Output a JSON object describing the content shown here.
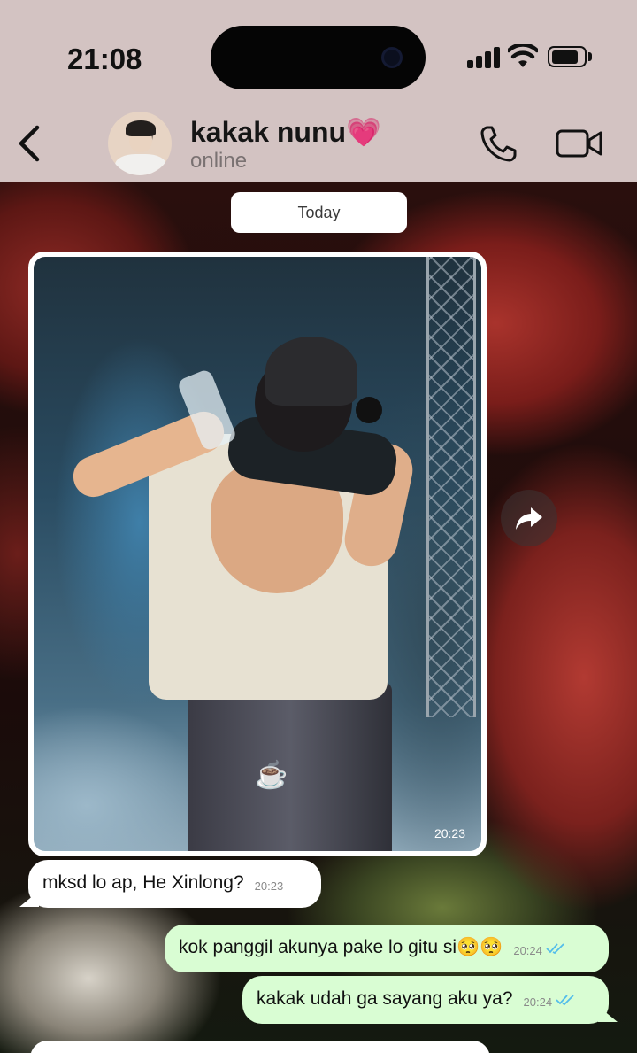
{
  "status_bar": {
    "time": "21:08"
  },
  "header": {
    "contact_name": "kakak nunu💗",
    "contact_status": "online"
  },
  "chat": {
    "date_label": "Today",
    "image_message": {
      "sticker": "☕",
      "time": "20:23"
    },
    "messages": [
      {
        "direction": "incoming",
        "text": "mksd lo ap, He Xinlong?",
        "time": "20:23"
      },
      {
        "direction": "outgoing",
        "text": "kok panggil akunya pake lo gitu si🥺🥺",
        "time": "20:24",
        "status": "read"
      },
      {
        "direction": "outgoing",
        "text": "kakak udah ga sayang aku ya?",
        "time": "20:24",
        "status": "read"
      }
    ]
  },
  "icons": {
    "back": "chevron-left-icon",
    "call": "phone-icon",
    "video": "video-camera-icon",
    "forward": "forward-arrow-icon",
    "read_receipt": "double-check-icon"
  },
  "colors": {
    "header_bg": "#d3c3c2",
    "outgoing_bubble": "#d9fdd3",
    "incoming_bubble": "#ffffff",
    "read_tick": "#53bdeb"
  }
}
